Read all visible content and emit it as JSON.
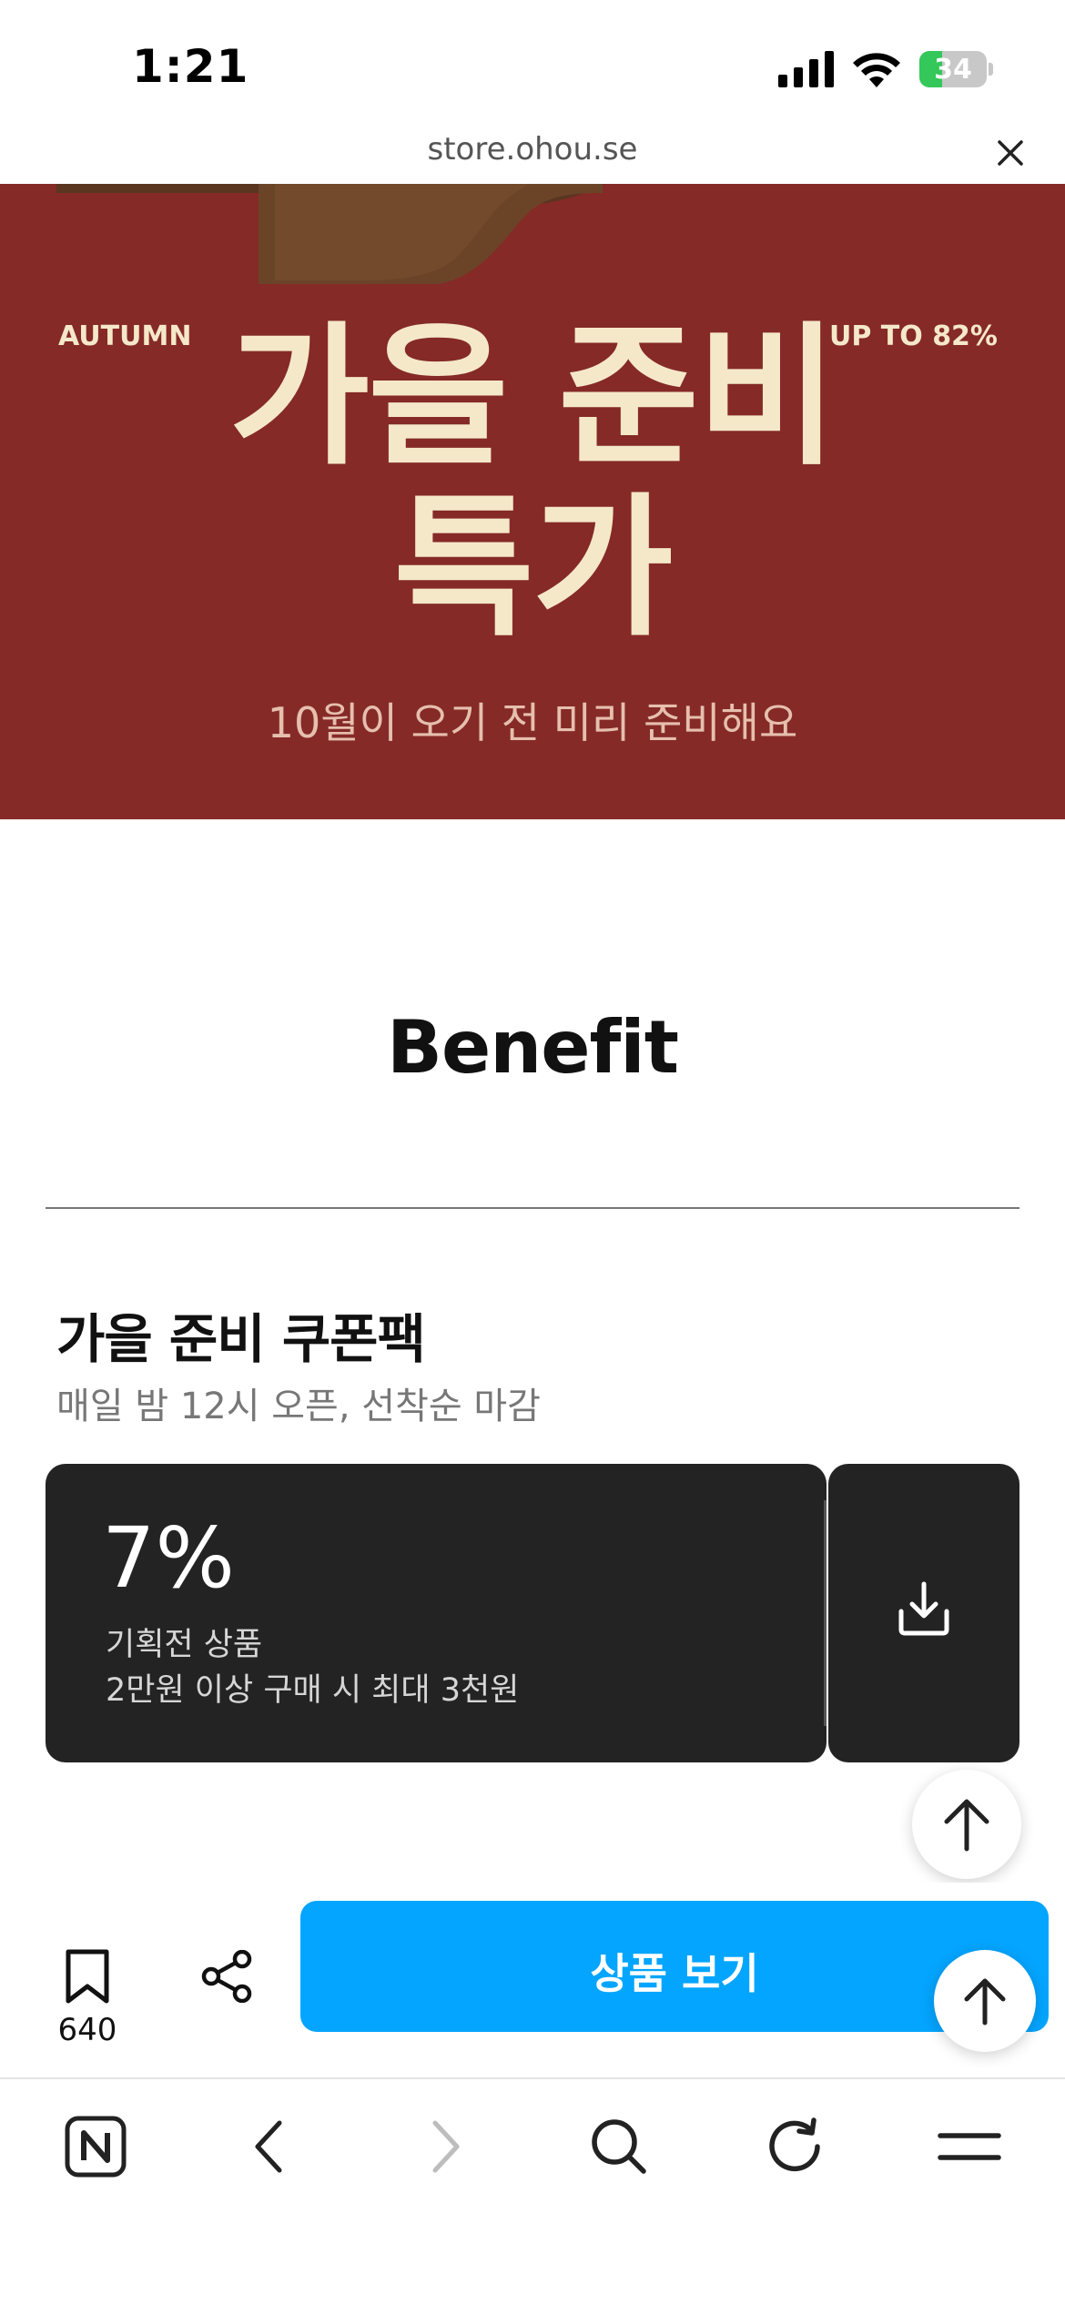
{
  "status_bar": {
    "time": "1:21",
    "battery": "34",
    "battery_level": 0.34,
    "battery_color": "#34c759",
    "icons": [
      "signal-icon",
      "wifi-icon",
      "battery-charging-icon"
    ]
  },
  "browser": {
    "url": "store.ohou.se",
    "close_icon": "close-icon"
  },
  "hero": {
    "background": "#852a27",
    "label_left": "AUTUMN",
    "label_right": "UP TO 82%",
    "title_line1": "가을 준비",
    "title_line2": "특가",
    "subtitle": "10월이 오기 전 미리 준비해요"
  },
  "benefit": {
    "heading": "Benefit",
    "coupon_pack_title": "가을 준비 쿠폰팩",
    "coupon_pack_subtitle": "매일 밤 12시 오픈, 선착순 마감",
    "coupon": {
      "percent": "7%",
      "line1": "기획전 상품",
      "line2": "2만원 이상 구매 시 최대 3천원",
      "download_icon": "download-icon"
    }
  },
  "action_bar": {
    "bookmark_count": "640",
    "view_products_label": "상품 보기",
    "accent": "#04a5ff"
  },
  "bottom_nav": {
    "items": [
      "naver-home-icon",
      "back-icon",
      "forward-icon",
      "search-icon",
      "reload-icon",
      "menu-icon"
    ]
  }
}
